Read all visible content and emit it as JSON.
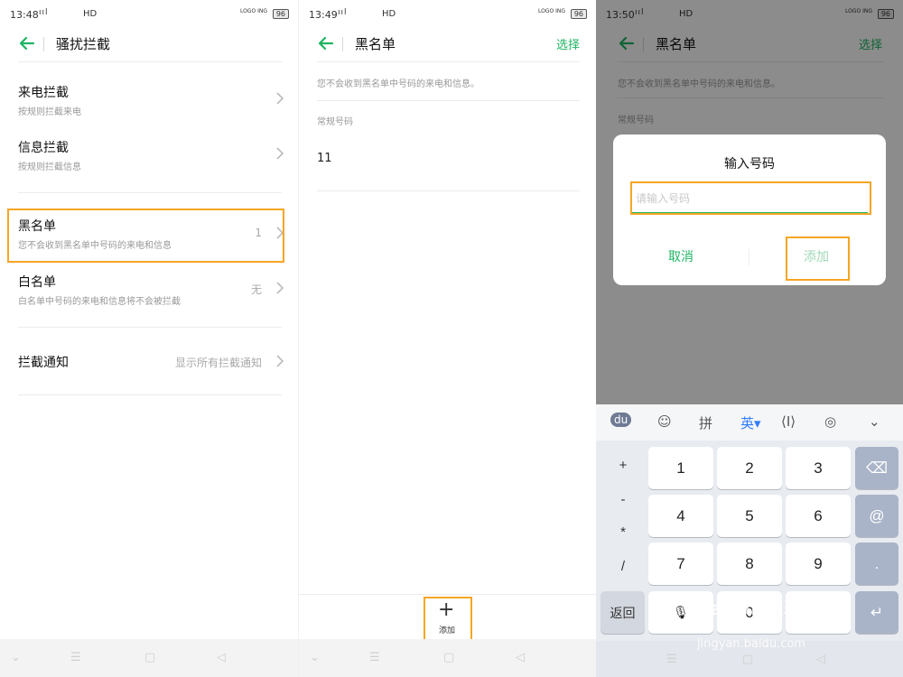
{
  "accent_color": "#1fb463",
  "highlight_color": "#f5a623",
  "panel1": {
    "status": {
      "time": "13:48",
      "signal": "ııl",
      "net": "0.00 KB/S",
      "hd": "HD",
      "logo": "LOGO ING",
      "battery": "96"
    },
    "title": "骚扰拦截",
    "rows": [
      {
        "label": "来电拦截",
        "sub": "按规则拦截来电",
        "value": ""
      },
      {
        "label": "信息拦截",
        "sub": "按规则拦截信息",
        "value": ""
      },
      {
        "label": "黑名单",
        "sub": "您不会收到黑名单中号码的来电和信息",
        "value": "1"
      },
      {
        "label": "白名单",
        "sub": "白名单中号码的来电和信息将不会被拦截",
        "value": "无"
      },
      {
        "label": "拦截通知",
        "sub": "",
        "value": "显示所有拦截通知"
      }
    ]
  },
  "panel2": {
    "status": {
      "time": "13:49",
      "signal": "ııl",
      "net": "0.00 KB/S",
      "hd": "HD",
      "logo": "LOGO ING",
      "battery": "96"
    },
    "title": "黑名单",
    "select_label": "选择",
    "hint": "您不会收到黑名单中号码的来电和信息。",
    "section_label": "常规号码",
    "numbers": [
      "11"
    ],
    "add_label": "添加"
  },
  "panel3": {
    "status": {
      "time": "13:50",
      "signal": "ııl",
      "net": "0.00 KB/S",
      "hd": "HD",
      "logo": "LOGO ING",
      "battery": "96"
    },
    "title": "黑名单",
    "select_label": "选择",
    "hint": "您不会收到黑名单中号码的来电和信息。",
    "section_label": "常规号码",
    "dialog": {
      "title": "输入号码",
      "placeholder": "请输入号码",
      "value": "",
      "cancel_label": "取消",
      "add_label": "添加"
    },
    "keyboard": {
      "toolbar": [
        "du",
        "☺",
        "拼",
        "英▾",
        "⟨I⟩",
        "◎",
        "⌄"
      ],
      "symbols": [
        "+",
        "-",
        "*",
        "/"
      ],
      "digits": [
        "1",
        "2",
        "3",
        "4",
        "5",
        "6",
        "7",
        "8",
        "9",
        "0"
      ],
      "right_keys": [
        "⌫",
        "@",
        "."
      ],
      "back_label": "返回",
      "enter_label": "↵"
    },
    "watermark": "Baidu 经验",
    "watermark_sub": "jingyan.baidu.com"
  }
}
